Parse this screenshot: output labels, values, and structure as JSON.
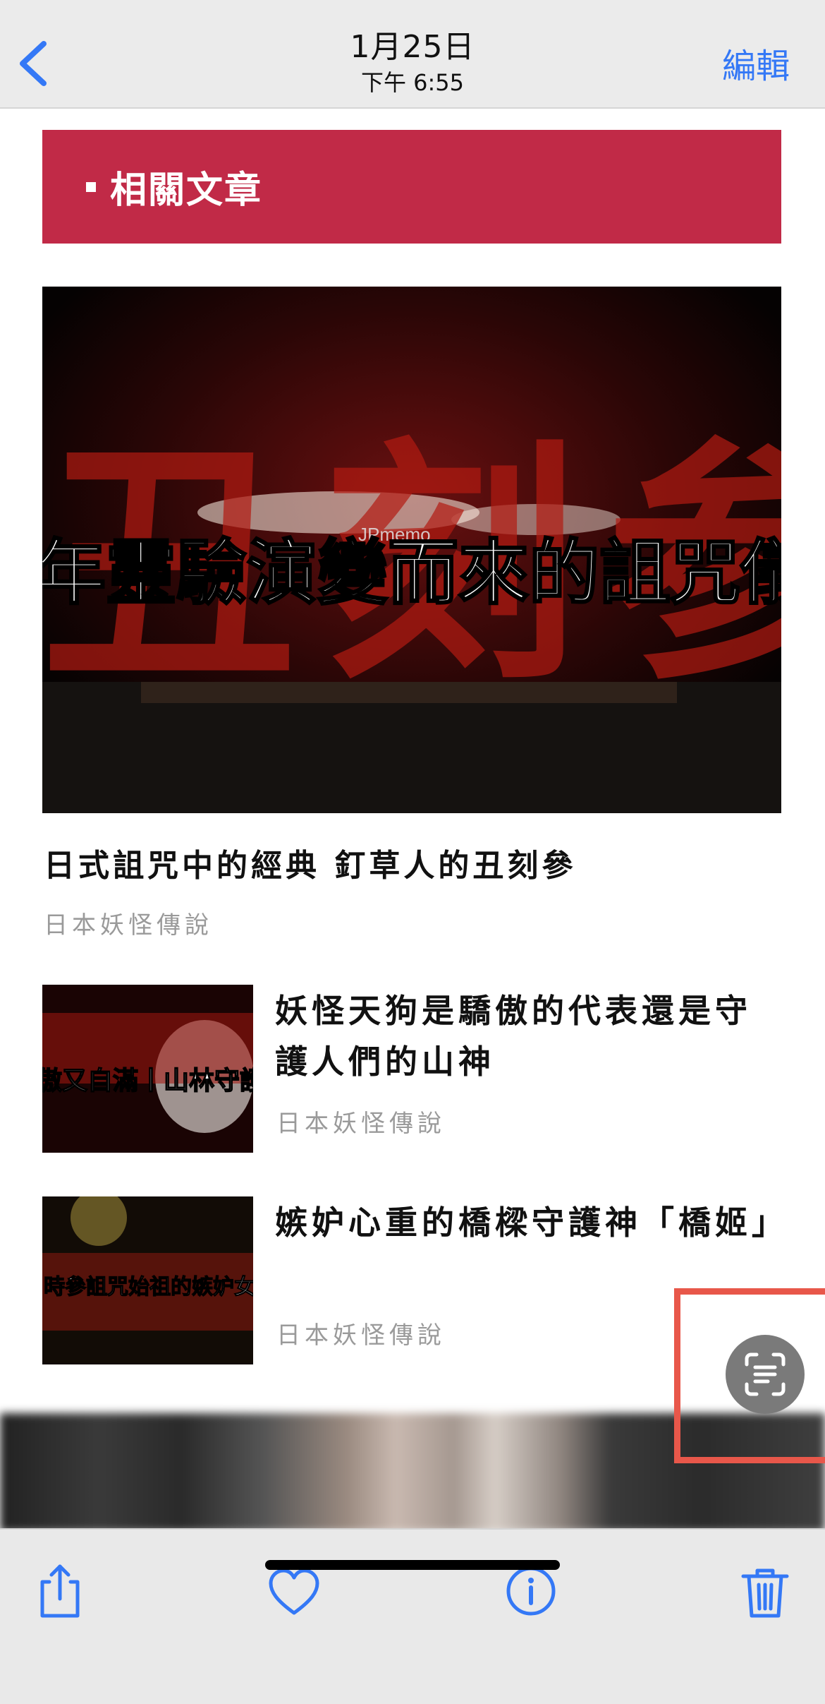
{
  "nav": {
    "date": "1月25日",
    "time": "下午 6:55",
    "edit_label": "編輯"
  },
  "banner": {
    "title": "相關文章"
  },
  "hero": {
    "overlay_text": "年靈驗演變而來的詛咒儀",
    "watermark": "JPmemo",
    "bg_chars": "丑刻参"
  },
  "articles": [
    {
      "title": "日式詛咒中的經典 釘草人的丑刻參",
      "category": "日本妖怪傳說"
    },
    {
      "title": "妖怪天狗是驕傲的代表還是守護人們的山神",
      "category": "日本妖怪傳說",
      "thumb_text": "傲又自滿丨山林守護"
    },
    {
      "title": "嫉妒心重的橋樑守護神「橋姬」",
      "category": "日本妖怪傳說",
      "thumb_text": "時參詛咒始祖的嫉妒女"
    }
  ],
  "toolbar": {
    "share": "share-icon",
    "favorite": "heart-icon",
    "info": "info-icon",
    "delete": "trash-icon"
  },
  "colors": {
    "accent": "#3478f6",
    "banner": "#c12a47",
    "highlight": "#e8574a"
  }
}
